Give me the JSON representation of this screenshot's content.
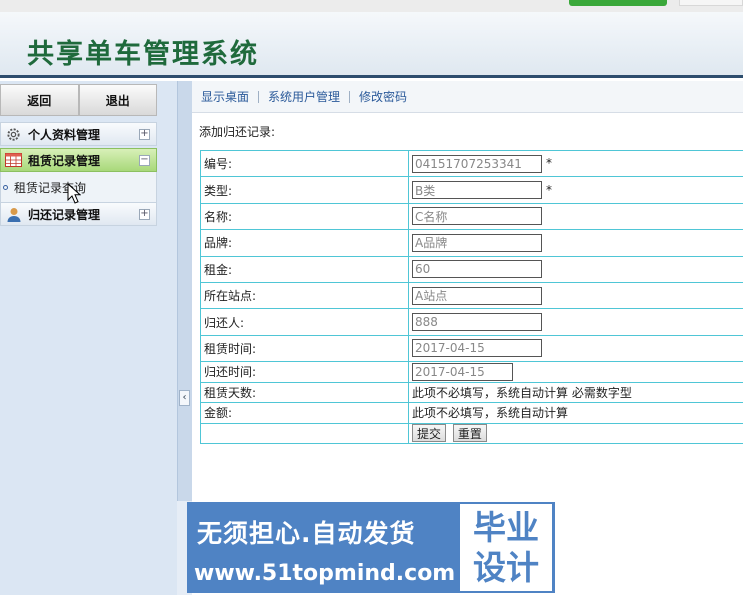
{
  "app": {
    "title": "共享单车管理系统"
  },
  "sidebar": {
    "back_label": "返回",
    "logout_label": "退出",
    "menus": [
      {
        "label": "个人资料管理",
        "icon": "gear-icon",
        "toggle": "+"
      },
      {
        "label": "租赁记录管理",
        "icon": "table-icon",
        "toggle": "−",
        "sub": "租赁记录查询"
      },
      {
        "label": "归还记录管理",
        "icon": "user-icon",
        "toggle": "+"
      }
    ]
  },
  "topnav": {
    "links": [
      "显示桌面",
      "系统用户管理",
      "修改密码"
    ]
  },
  "form": {
    "title": "添加归还记录:",
    "required_mark": "*",
    "rows": [
      {
        "label": "编号:",
        "value": "04151707253341"
      },
      {
        "label": "类型:",
        "value": "B类"
      },
      {
        "label": "名称:",
        "value": "C名称"
      },
      {
        "label": "品牌:",
        "value": "A品牌"
      },
      {
        "label": "租金:",
        "value": "60"
      },
      {
        "label": "所在站点:",
        "value": "A站点"
      },
      {
        "label": "归还人:",
        "value": "888"
      },
      {
        "label": "租赁时间:",
        "value": "2017-04-15"
      },
      {
        "label": "归还时间:",
        "value": "2017-04-15"
      },
      {
        "label": "租赁天数:",
        "text": "此项不必填写，系统自动计算 必需数字型"
      },
      {
        "label": "金额:",
        "text": "此项不必填写，系统自动计算"
      }
    ],
    "submit_label": "提交",
    "reset_label": "重置"
  },
  "watermark": {
    "line1": "无须担心.自动发货",
    "line2": "www.51topmind.com",
    "box1": "毕业",
    "box2": "设计"
  },
  "colors": {
    "accent": "#1f6a3c",
    "table_border": "#4fc6d6",
    "sidebar_bg": "#dbe6f3"
  }
}
